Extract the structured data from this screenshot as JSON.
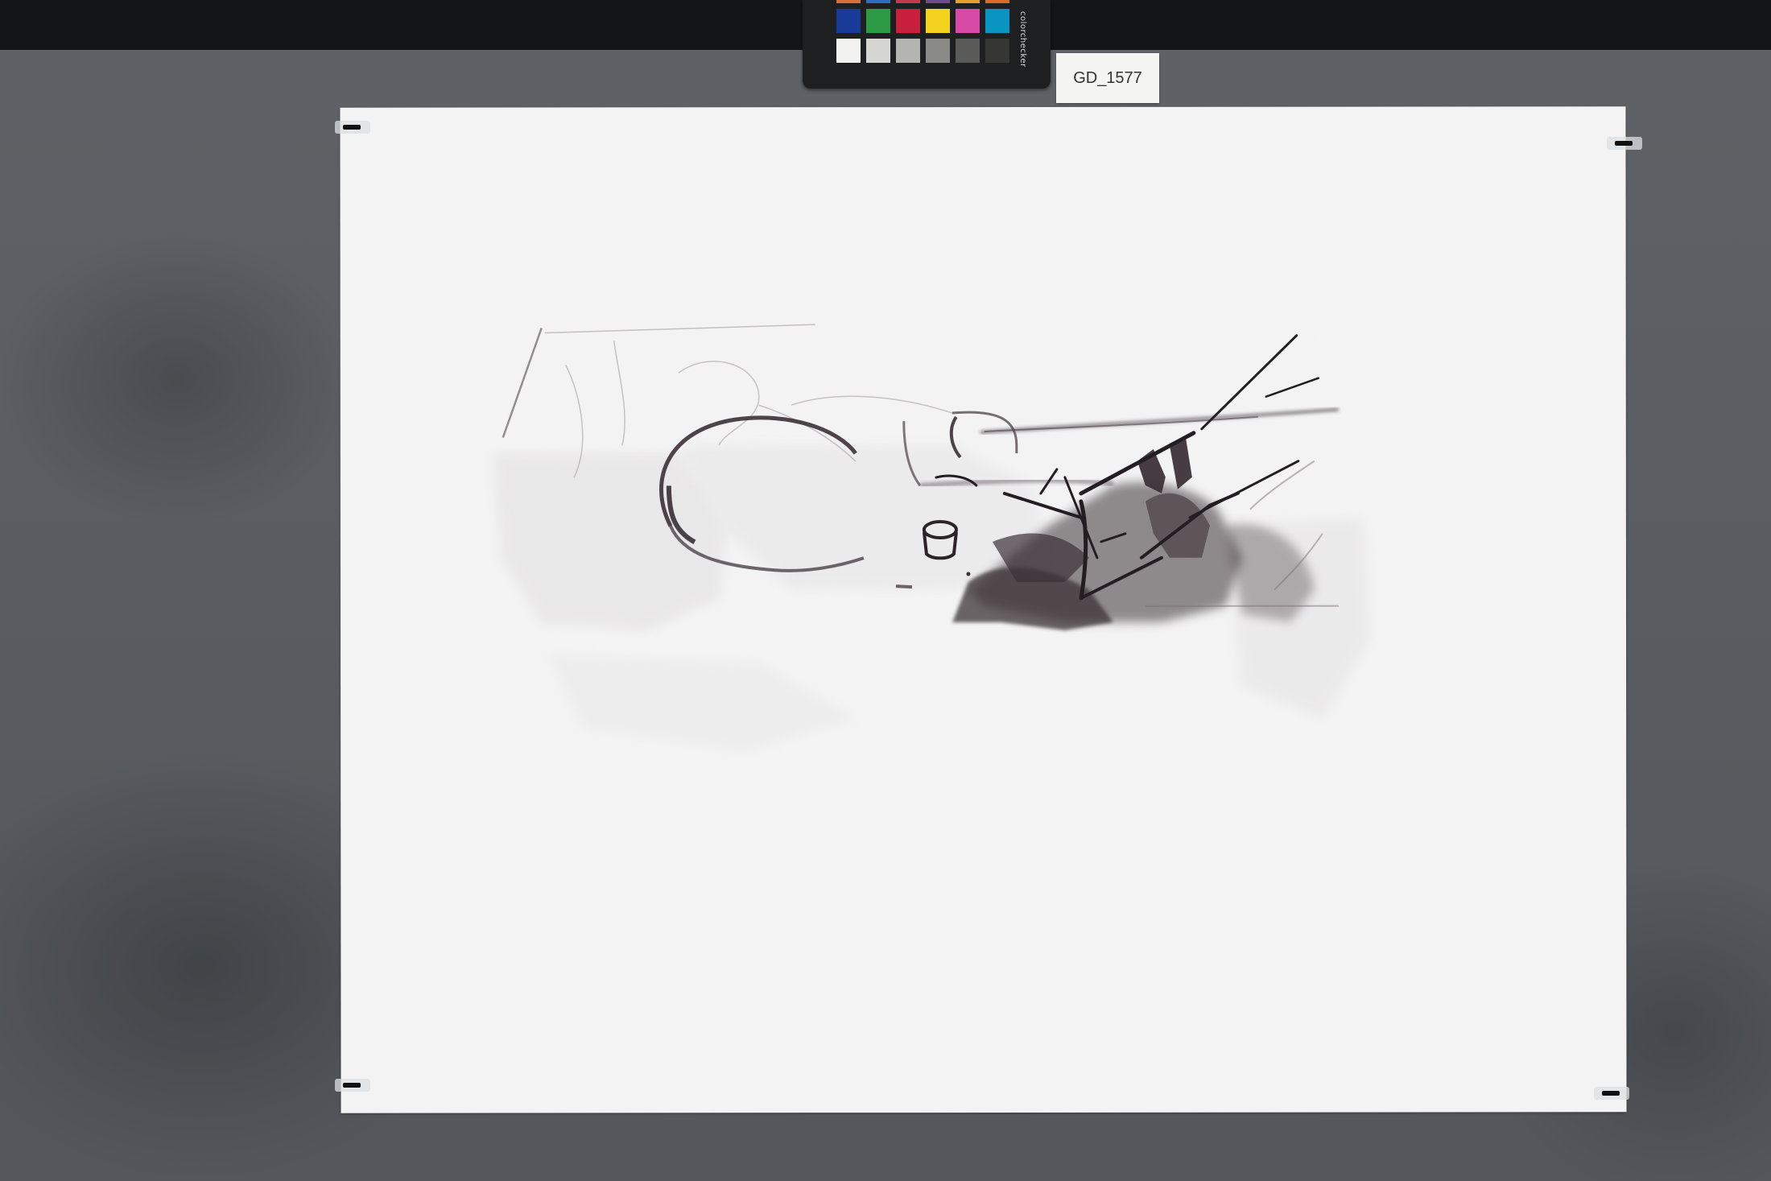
{
  "scene": {
    "label_text": "GD_1577",
    "checker_brand_text": "colorchecker",
    "checker_patches": [
      "#d8703a",
      "#2c6fc0",
      "#c23a4c",
      "#6c4c8a",
      "#e5a12e",
      "#d86a2a",
      "#1a3a9a",
      "#2c9a44",
      "#c8203c",
      "#f2d21e",
      "#d84aa6",
      "#0a94c2",
      "#f2f2f0",
      "#d6d6d4",
      "#b4b4b2",
      "#8a8a88",
      "#5a5a58",
      "#363634"
    ],
    "background_color": "#5a5d61",
    "paper_color": "#f4f4f4",
    "ink_color": "#3b3036"
  }
}
